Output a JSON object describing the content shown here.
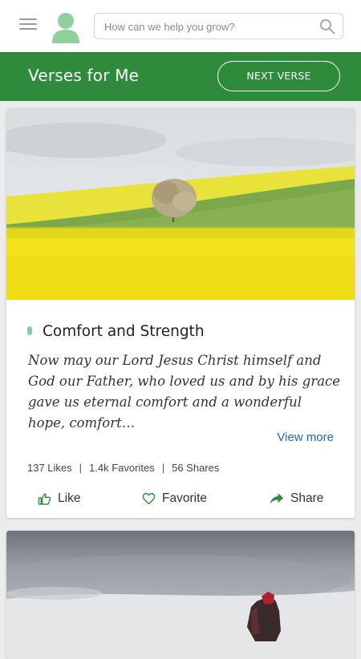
{
  "header": {
    "search_placeholder": "How can we help you grow?"
  },
  "banner": {
    "title": "Verses for Me",
    "next_label": "NEXT VERSE"
  },
  "verse_card": {
    "title": "Comfort and Strength",
    "text": "Now may our Lord Jesus Christ himself and God our Father, who loved us and by his grace gave us eternal comfort and a wonderful hope, comfort…",
    "view_more": "View more",
    "stats": {
      "likes": "137 Likes",
      "favorites": "1.4k Favorites",
      "shares": "56 Shares"
    },
    "actions": {
      "like": "Like",
      "favorite": "Favorite",
      "share": "Share"
    }
  },
  "colors": {
    "brand_green": "#2e8b3c",
    "accent_green": "#7fd1a3",
    "link_blue": "#2166b0"
  },
  "icons": [
    "menu-icon",
    "avatar-icon",
    "search-icon",
    "thumbs-up-icon",
    "heart-icon",
    "share-arrow-icon"
  ]
}
